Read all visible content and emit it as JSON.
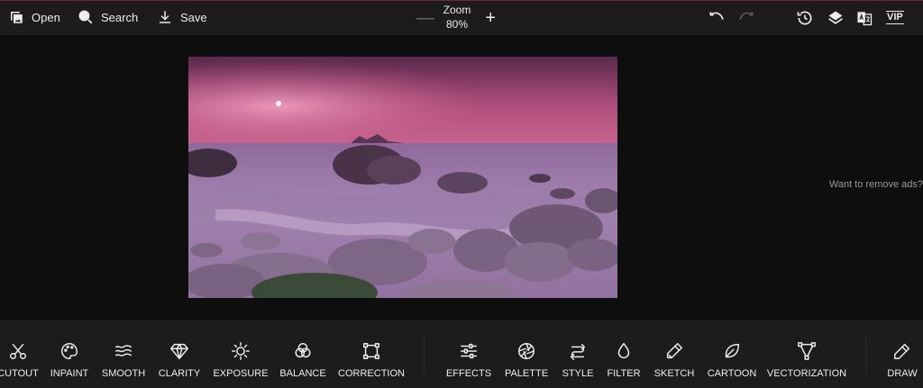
{
  "toolbar": {
    "open_label": "Open",
    "search_label": "Search",
    "save_label": "Save",
    "zoom_label": "Zoom",
    "zoom_value": "80%",
    "vip_label": "VIP"
  },
  "canvas": {
    "ads_text": "Want to remove ads?"
  },
  "tools_left": [
    {
      "label": "CUTOUT",
      "icon": "scissors-icon"
    },
    {
      "label": "INPAINT",
      "icon": "palette-brush-icon"
    },
    {
      "label": "SMOOTH",
      "icon": "waves-icon"
    },
    {
      "label": "CLARITY",
      "icon": "diamond-icon"
    },
    {
      "label": "EXPOSURE",
      "icon": "sun-icon"
    },
    {
      "label": "BALANCE",
      "icon": "color-circles-icon"
    },
    {
      "label": "CORRECTION",
      "icon": "crop-frame-icon"
    }
  ],
  "tools_right": [
    {
      "label": "EFFECTS",
      "icon": "sliders-icon"
    },
    {
      "label": "PALETTE",
      "icon": "aperture-icon"
    },
    {
      "label": "STYLE",
      "icon": "style-swirl-icon"
    },
    {
      "label": "FILTER",
      "icon": "droplet-icon"
    },
    {
      "label": "SKETCH",
      "icon": "pencil-icon"
    },
    {
      "label": "CARTOON",
      "icon": "leaf-icon"
    },
    {
      "label": "VECTORIZATION",
      "icon": "vector-nodes-icon"
    }
  ],
  "tools_extra": [
    {
      "label": "DRAW",
      "icon": "pen-icon"
    }
  ],
  "colors": {
    "topbar_bg": "#1c1c1c",
    "canvas_bg": "#0e0e0e",
    "text": "#ededed",
    "sky_top": "#5a2a4c",
    "sky_glow": "#c45a86"
  }
}
